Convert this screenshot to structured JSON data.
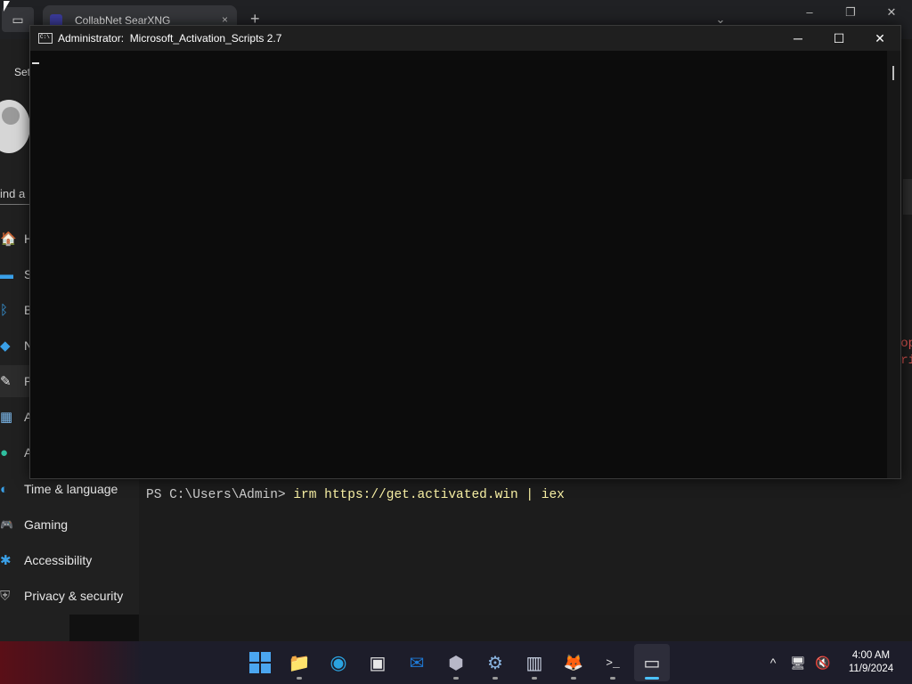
{
  "browser": {
    "tab_title": "CollabNet SearXNG",
    "tab_close_icon": "×",
    "new_tab_icon": "+",
    "dropdown_icon": "⌄",
    "minimize_icon": "–",
    "restore_icon": "❐",
    "close_icon": "✕"
  },
  "settings": {
    "title": "Set",
    "search_text": "ind a",
    "nav_items": [
      {
        "icon": "🏠",
        "label": "H"
      },
      {
        "icon": "▬",
        "label": "S"
      },
      {
        "icon": "ᛒ",
        "label": "B"
      },
      {
        "icon": "◆",
        "label": "N"
      },
      {
        "icon": "✎",
        "label": "P"
      },
      {
        "icon": "▦",
        "label": "A"
      },
      {
        "icon": "●",
        "label": "A"
      },
      {
        "icon": "◐",
        "label": "Time & language"
      },
      {
        "icon": "🎮",
        "label": "Gaming"
      },
      {
        "icon": "✱",
        "label": "Accessibility"
      },
      {
        "icon": "⛨",
        "label": "Privacy & security"
      }
    ]
  },
  "red_fragments": [
    "op",
    "ri"
  ],
  "powershell": {
    "prompt": "PS C:\\Users\\Admin> ",
    "command": "irm https://get.activated.win | iex"
  },
  "console": {
    "title": "Administrator:  Microsoft_Activation_Scripts 2.7",
    "icon_text": "C:\\",
    "minimize_icon": "─",
    "maximize_icon": "☐",
    "close_icon": "✕"
  },
  "taskbar": {
    "items": [
      {
        "name": "start",
        "label": ""
      },
      {
        "name": "file-explorer",
        "label": "📁"
      },
      {
        "name": "edge",
        "label": "◉"
      },
      {
        "name": "store",
        "label": "▣"
      },
      {
        "name": "outlook",
        "label": "✉"
      },
      {
        "name": "box-app",
        "label": "⬢"
      },
      {
        "name": "settings",
        "label": "⚙"
      },
      {
        "name": "archive-app",
        "label": "▥"
      },
      {
        "name": "firefox",
        "label": "🦊"
      },
      {
        "name": "terminal",
        "label": ">_"
      },
      {
        "name": "console",
        "label": "▭"
      }
    ],
    "tray": {
      "chevron": "^",
      "network": "🖥",
      "volume": "🔇",
      "time": "4:00 AM",
      "date": "11/9/2024"
    }
  }
}
